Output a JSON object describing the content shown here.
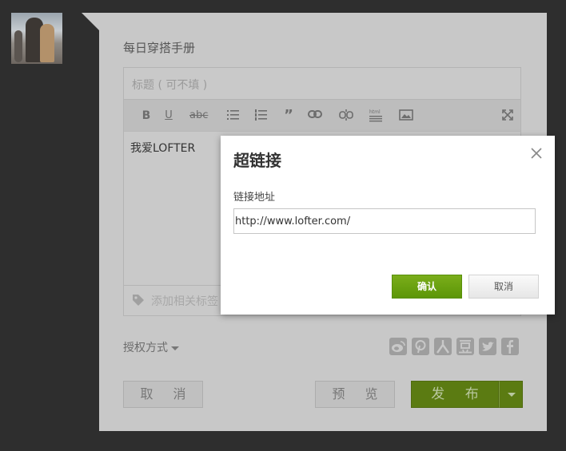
{
  "post": {
    "label": "每日穿搭手册",
    "title_placeholder": "标题 ( 可不填 )",
    "body_text": "我爱LOFTER",
    "tag_placeholder": "添加相关标签"
  },
  "toolbar": {
    "bold": "B",
    "underline": "U",
    "strike": "abc"
  },
  "footer": {
    "license_label": "授权方式",
    "cancel_label": "取 消",
    "preview_label": "预 览",
    "publish_label": "发 布",
    "share_icons": [
      "weibo-icon",
      "pinterest-icon",
      "renren-icon",
      "douban-icon",
      "twitter-icon",
      "facebook-icon"
    ]
  },
  "dialog": {
    "title": "超链接",
    "url_label": "链接地址",
    "url_value": "http://www.lofter.com/",
    "confirm_label": "确认",
    "cancel_label": "取消"
  },
  "colors": {
    "accent_green": "#6aa30f",
    "backdrop": "#2e2e2e"
  }
}
